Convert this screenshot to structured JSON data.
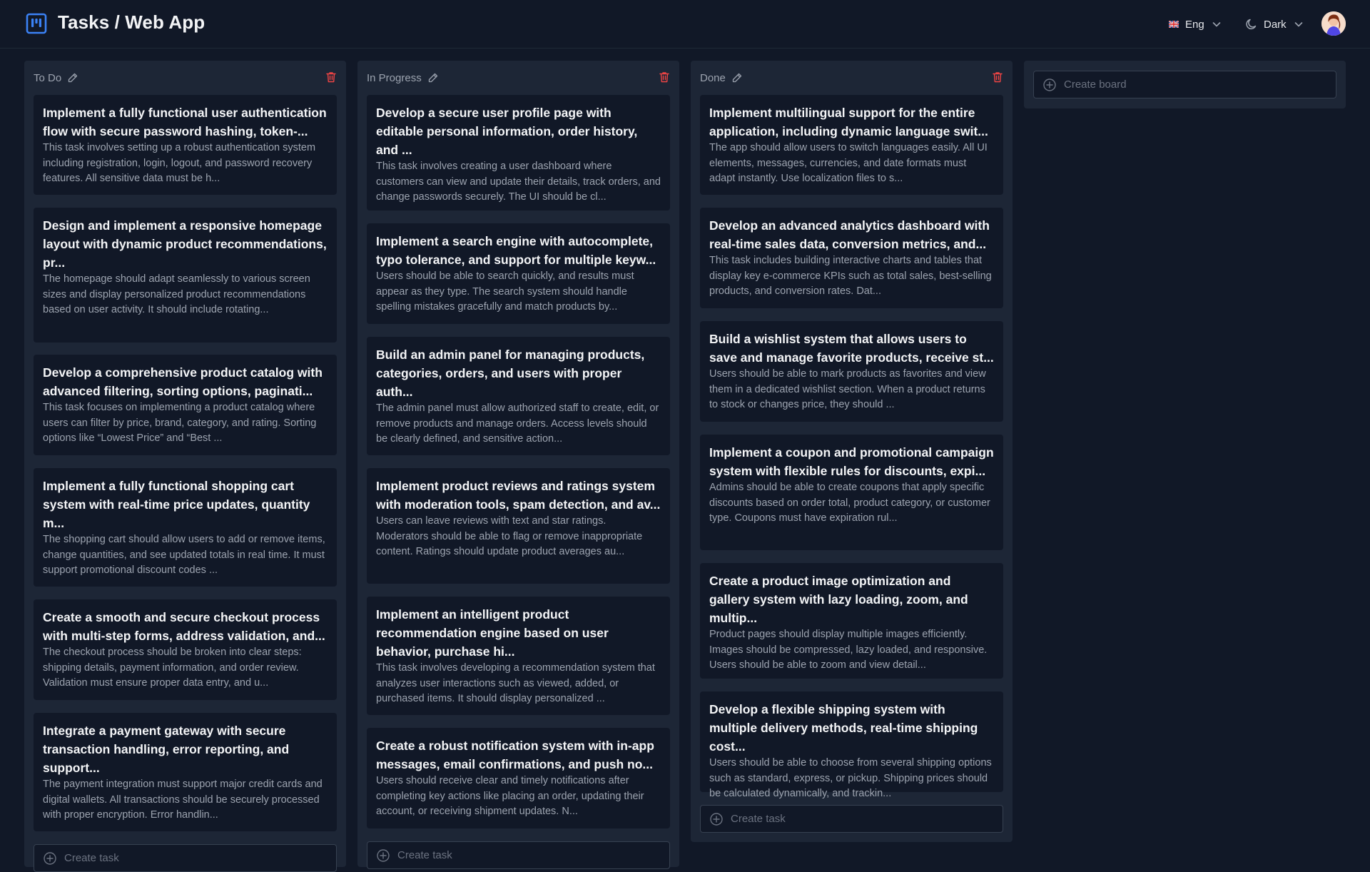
{
  "header": {
    "title": "Tasks / Web App",
    "language": "Eng",
    "theme": "Dark"
  },
  "colors": {
    "background": "#111827",
    "column": "#1d2636",
    "card": "#111827",
    "accent": "#3b82f6",
    "danger": "#ef4444"
  },
  "columns": [
    {
      "title": "To Do",
      "create_label": "Create task",
      "cards": [
        {
          "title": "Implement a fully functional user authentication flow with secure password hashing, token-...",
          "description": "This task involves setting up a robust authentication system including registration, login, logout, and password recovery features. All sensitive data must be h..."
        },
        {
          "title": "Design and implement a responsive homepage layout with dynamic product recommendations, pr...",
          "description": "The homepage should adapt seamlessly to various screen sizes and display personalized product recommendations based on user activity. It should include rotating..."
        },
        {
          "title": "Develop a comprehensive product catalog with advanced filtering, sorting options, paginati...",
          "description": "This task focuses on implementing a product catalog where users can filter by price, brand, category, and rating. Sorting options like “Lowest Price” and “Best ..."
        },
        {
          "title": "Implement a fully functional shopping cart system with real-time price updates, quantity m...",
          "description": "The shopping cart should allow users to add or remove items, change quantities, and see updated totals in real time. It must support promotional discount codes ..."
        },
        {
          "title": "Create a smooth and secure checkout process with multi-step forms, address validation, and...",
          "description": "The checkout process should be broken into clear steps: shipping details, payment information, and order review. Validation must ensure proper data entry, and u..."
        },
        {
          "title": "Integrate a payment gateway with secure transaction handling, error reporting, and support...",
          "description": "The payment integration must support major credit cards and digital wallets. All transactions should be securely processed with proper encryption. Error handlin..."
        }
      ]
    },
    {
      "title": "In Progress",
      "create_label": "Create task",
      "cards": [
        {
          "title": "Develop a secure user profile page with editable personal information, order history, and ...",
          "description": "This task involves creating a user dashboard where customers can view and update their details, track orders, and change passwords securely. The UI should be cl..."
        },
        {
          "title": "Implement a search engine with autocomplete, typo tolerance, and support for multiple keyw...",
          "description": "Users should be able to search quickly, and results must appear as they type. The search system should handle spelling mistakes gracefully and match products by..."
        },
        {
          "title": "Build an admin panel for managing products, categories, orders, and users with proper auth...",
          "description": "The admin panel must allow authorized staff to create, edit, or remove products and manage orders. Access levels should be clearly defined, and sensitive action..."
        },
        {
          "title": "Implement product reviews and ratings system with moderation tools, spam detection, and av...",
          "description": "Users can leave reviews with text and star ratings. Moderators should be able to flag or remove inappropriate content. Ratings should update product averages au..."
        },
        {
          "title": "Implement an intelligent product recommendation engine based on user behavior, purchase hi...",
          "description": "This task involves developing a recommendation system that analyzes user interactions such as viewed, added, or purchased items. It should display personalized ..."
        },
        {
          "title": "Create a robust notification system with in-app messages, email confirmations, and push no...",
          "description": "Users should receive clear and timely notifications after completing key actions like placing an order, updating their account, or receiving shipment updates. N..."
        }
      ]
    },
    {
      "title": "Done",
      "create_label": "Create task",
      "cards": [
        {
          "title": "Implement multilingual support for the entire application, including dynamic language swit...",
          "description": "The app should allow users to switch languages easily. All UI elements, messages, currencies, and date formats must adapt instantly. Use localization files to s..."
        },
        {
          "title": "Develop an advanced analytics dashboard with real-time sales data, conversion metrics, and...",
          "description": "This task includes building interactive charts and tables that display key e-commerce KPIs such as total sales, best-selling products, and conversion rates. Dat..."
        },
        {
          "title": "Build a wishlist system that allows users to save and manage favorite products, receive st...",
          "description": "Users should be able to mark products as favorites and view them in a dedicated wishlist section. When a product returns to stock or changes price, they should ..."
        },
        {
          "title": "Implement a coupon and promotional campaign system with flexible rules for discounts, expi...",
          "description": "Admins should be able to create coupons that apply specific discounts based on order total, product category, or customer type. Coupons must have expiration rul..."
        },
        {
          "title": "Create a product image optimization and gallery system with lazy loading, zoom, and multip...",
          "description": "Product pages should display multiple images efficiently. Images should be compressed, lazy loaded, and responsive. Users should be able to zoom and view detail..."
        },
        {
          "title": "Develop a flexible shipping system with multiple delivery methods, real-time shipping cost...",
          "description": "Users should be able to choose from several shipping options such as standard, express, or pickup. Shipping prices should be calculated dynamically, and trackin..."
        }
      ]
    }
  ],
  "board": {
    "create_label": "Create board"
  }
}
